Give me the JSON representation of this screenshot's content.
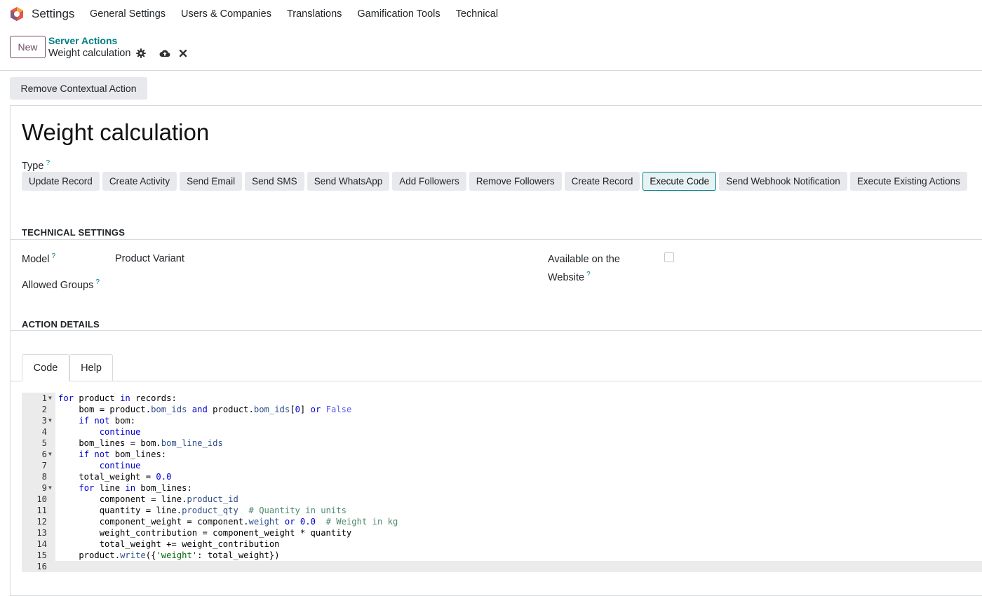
{
  "app": {
    "title": "Settings"
  },
  "menu": [
    "General Settings",
    "Users & Companies",
    "Translations",
    "Gamification Tools",
    "Technical"
  ],
  "control": {
    "new_label": "New",
    "breadcrumb_parent": "Server Actions",
    "breadcrumb_current": "Weight calculation"
  },
  "statusbar": {
    "remove_label": "Remove Contextual Action"
  },
  "record": {
    "title": "Weight calculation"
  },
  "type": {
    "label": "Type",
    "help": "?",
    "options": [
      "Update Record",
      "Create Activity",
      "Send Email",
      "Send SMS",
      "Send WhatsApp",
      "Add Followers",
      "Remove Followers",
      "Create Record",
      "Execute Code",
      "Send Webhook Notification",
      "Execute Existing Actions"
    ],
    "selected": "Execute Code"
  },
  "technical": {
    "section_title": "TECHNICAL SETTINGS",
    "model_label": "Model",
    "model_value": "Product Variant",
    "groups_label": "Allowed Groups",
    "website_label_1": "Available on the",
    "website_label_2": "Website",
    "website_checked": false,
    "help": "?"
  },
  "details": {
    "section_title": "ACTION DETAILS",
    "tabs": [
      "Code",
      "Help"
    ],
    "active_tab": "Code"
  },
  "code": {
    "lines": [
      "for product in records:",
      "    bom = product.bom_ids and product.bom_ids[0] or False",
      "    if not bom:",
      "        continue",
      "    bom_lines = bom.bom_line_ids",
      "    if not bom_lines:",
      "        continue",
      "    total_weight = 0.0",
      "    for line in bom_lines:",
      "        component = line.product_id",
      "        quantity = line.product_qty  # Quantity in units",
      "        component_weight = component.weight or 0.0  # Weight in kg",
      "        weight_contribution = component_weight * quantity",
      "        total_weight += weight_contribution",
      "    product.write({'weight': total_weight})",
      ""
    ],
    "foldable": [
      1,
      3,
      6,
      9
    ],
    "current_line": 16
  },
  "colors": {
    "brand": "#714b67",
    "accent": "#017e84"
  },
  "icons": {
    "logo": "odoo-logo",
    "gear": "gear-icon",
    "save": "cloud-upload-icon",
    "discard": "close-icon"
  }
}
